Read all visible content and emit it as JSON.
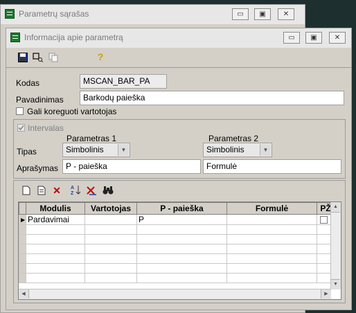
{
  "back_window": {
    "title": "Parametrų sąrašas"
  },
  "window": {
    "title": "Informacija apie parametrą",
    "controls": {
      "minimize": "▭",
      "maximize": "▣",
      "close": "✕"
    }
  },
  "toolbar": {
    "icons": [
      "save-icon",
      "key-tool-icon",
      "copy-icon",
      "help-icon"
    ],
    "help_glyph": "?"
  },
  "form": {
    "kodas_label": "Kodas",
    "kodas_value": "MSCAN_BAR_PA",
    "pavadinimas_label": "Pavadinimas",
    "pavadinimas_value": "Barkodų paieška",
    "gali_koreguoti_label": "Gali koreguoti vartotojas",
    "gali_koreguoti_checked": false
  },
  "interval": {
    "label": "Intervalas",
    "checked": true,
    "param1_header": "Parametras 1",
    "param2_header": "Parametras 2",
    "tipas_label": "Tipas",
    "tipas1_value": "Simbolinis",
    "tipas2_value": "Simbolinis",
    "aprasymas_label": "Aprašymas",
    "aprasymas1_value": "P - paieška",
    "aprasymas2_value": "Formulė"
  },
  "grid": {
    "columns": [
      "Modulis",
      "Vartotojas",
      "P - paieška",
      "Formulė",
      "PŽ"
    ],
    "rows": [
      {
        "modulis": "Pardavimai",
        "vartotojas": "",
        "p_paieska": "P",
        "formule": "",
        "pz": false
      }
    ],
    "empty_rows": 6
  },
  "colors": {
    "accent": "#1c7a2e",
    "desktop": "#1e2f2f",
    "window": "#d4d0c8"
  }
}
